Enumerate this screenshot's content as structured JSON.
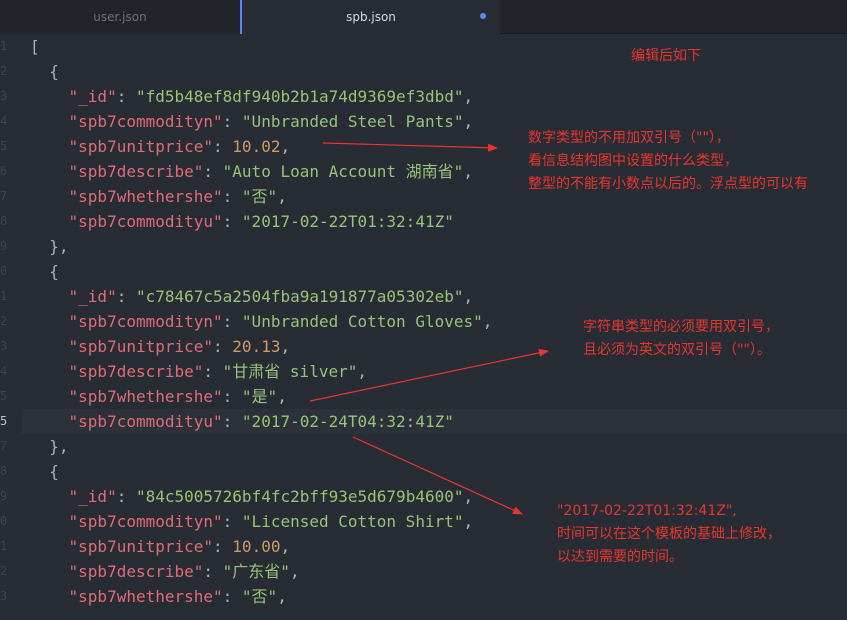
{
  "tabs": [
    {
      "label": "user.json",
      "active": false
    },
    {
      "label": "spb.json",
      "active": true,
      "modified": true
    }
  ],
  "gutter": [
    "1",
    "2",
    "3",
    "4",
    "5",
    "6",
    "7",
    "8",
    "9",
    "0",
    "1",
    "2",
    "3",
    "4",
    "5",
    "5",
    "7",
    "8",
    "9",
    "0",
    "1",
    "2",
    "3"
  ],
  "code": {
    "l1": "[",
    "l2": "  {",
    "obj1": {
      "_id": "\"fd5b48ef8df940b2b1a74d9369ef3dbd\"",
      "spb7commodityn": "\"Unbranded Steel Pants\"",
      "spb7unitprice": "10.02",
      "spb7describe": "\"Auto Loan Account 湖南省\"",
      "spb7whethershe": "\"否\"",
      "spb7commodityu": "\"2017-02-22T01:32:41Z\""
    },
    "obj2": {
      "_id": "\"c78467c5a2504fba9a191877a05302eb\"",
      "spb7commodityn": "\"Unbranded Cotton Gloves\"",
      "spb7unitprice": "20.13",
      "spb7describe": "\"甘肃省 silver\"",
      "spb7whethershe": "\"是\"",
      "spb7commodityu": "\"2017-02-24T04:32:41Z\""
    },
    "obj3": {
      "_id": "\"84c5005726bf4fc2bff93e5d679b4600\"",
      "spb7commodityn": "\"Licensed Cotton Shirt\"",
      "spb7unitprice": "10.00",
      "spb7describe": "\"广东省\"",
      "spb7whethershe": "\"否\""
    },
    "keys": {
      "id": "\"_id\"",
      "commodityn": "\"spb7commodityn\"",
      "unitprice": "\"spb7unitprice\"",
      "describe": "\"spb7describe\"",
      "whethershe": "\"spb7whethershe\"",
      "commodityu": "\"spb7commodityu\""
    }
  },
  "annotations": {
    "title": "编辑后如下",
    "number_note": [
      "数字类型的不用加双引号（\"\"），",
      "看信息结构图中设置的什么类型，",
      "整型的不能有小数点以后的。浮点型的可以有"
    ],
    "string_note": [
      "字符串类型的必须要用双引号，",
      "且必须为英文的双引号（\"\"）。"
    ],
    "time_note": [
      "\"2017-02-22T01:32:41Z\",",
      "时间可以在这个模板的基础上修改，",
      "以达到需要的时间。"
    ]
  },
  "colors": {
    "annotation": "#e8362f",
    "key": "#e06c75",
    "string": "#98c379",
    "number": "#d19a66",
    "accent": "#568af2"
  }
}
